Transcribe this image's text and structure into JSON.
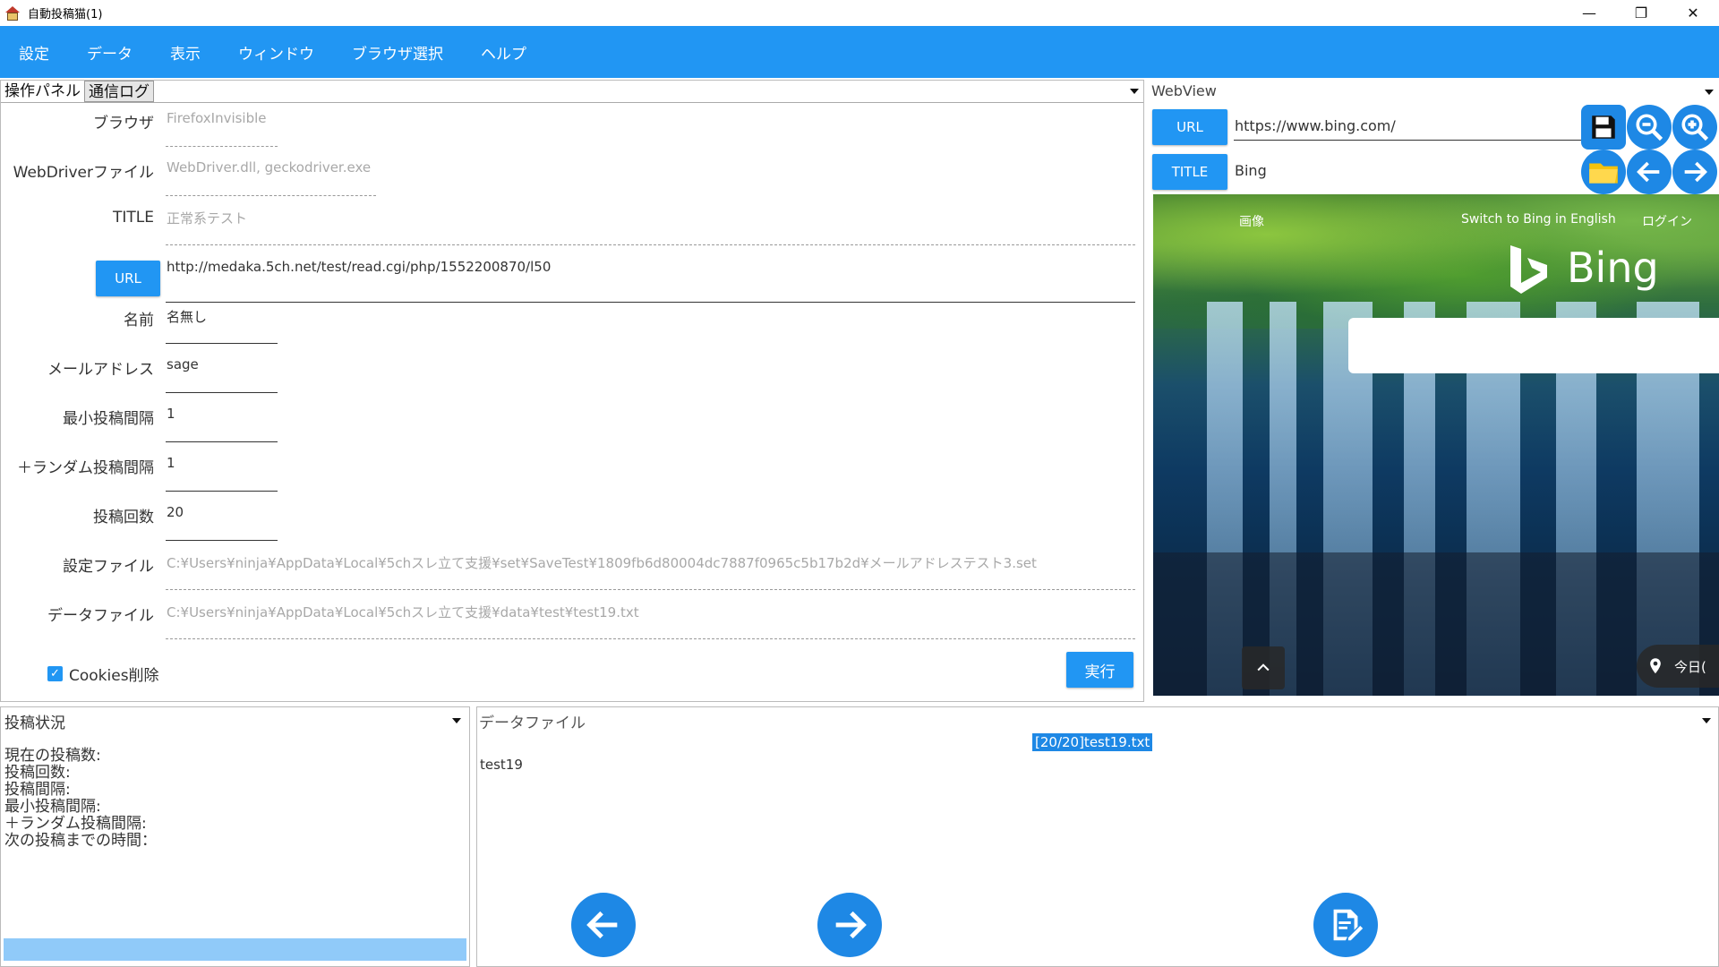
{
  "window": {
    "title": "自動投稿猫(1)",
    "controls": {
      "minimize": "—",
      "maximize": "❐",
      "close": "✕"
    }
  },
  "menubar": {
    "items": [
      "設定",
      "データ",
      "表示",
      "ウィンドウ",
      "ブラウザ選択",
      "ヘルプ"
    ]
  },
  "op_panel": {
    "tabs": [
      "操作パネル",
      "通信ログ"
    ],
    "fields": {
      "browser": {
        "label": "ブラウザ",
        "value": "FirefoxInvisible"
      },
      "webdriver": {
        "label": "WebDriverファイル",
        "value": "WebDriver.dll, geckodriver.exe"
      },
      "title": {
        "label": "TITLE",
        "value": "正常系テスト"
      },
      "url": {
        "button": "URL",
        "value": "http://medaka.5ch.net/test/read.cgi/php/1552200870/l50"
      },
      "name": {
        "label": "名前",
        "value": "名無し"
      },
      "mail": {
        "label": "メールアドレス",
        "value": "sage"
      },
      "min_interval": {
        "label": "最小投稿間隔",
        "value": "1"
      },
      "random_interval": {
        "label": "＋ランダム投稿間隔",
        "value": "1"
      },
      "post_count": {
        "label": "投稿回数",
        "value": "20"
      },
      "settings_file": {
        "label": "設定ファイル",
        "value": "C:¥Users¥ninja¥AppData¥Local¥5chスレ立て支援¥set¥SaveTest¥1809fb6d80004dc7887f0965c5b17b2d¥メールアドレステスト3.set"
      },
      "data_file": {
        "label": "データファイル",
        "value": "C:¥Users¥ninja¥AppData¥Local¥5chスレ立て支援¥data¥test¥test19.txt"
      }
    },
    "cookies": {
      "label": "Cookies削除",
      "checked": true
    },
    "run_button": "実行"
  },
  "webview": {
    "title": "WebView",
    "url_button": "URL",
    "url_value": "https://www.bing.com/",
    "title_button": "TITLE",
    "title_value": "Bing",
    "icons": [
      "save-icon",
      "zoom-out-icon",
      "zoom-in-icon",
      "folder-icon",
      "back-icon",
      "forward-icon"
    ],
    "page": {
      "images_link": "画像",
      "switch_link": "Switch to Bing in English",
      "login_link": "ログイン",
      "logo_text": "Bing",
      "today_label": "今日(",
      "colors": {
        "foliage": "#5c9b3b",
        "water": "#0e3a62"
      }
    }
  },
  "status_panel": {
    "title": "投稿状況",
    "lines": [
      "現在の投稿数:",
      "投稿回数:",
      "投稿間隔:",
      "最小投稿間隔:",
      "＋ランダム投稿間隔:",
      "次の投稿までの時間："
    ],
    "progress": 1.0
  },
  "data_panel": {
    "title": "データファイル",
    "badge": "[20/20]test19.txt",
    "content": "test19",
    "buttons": [
      "back-icon",
      "forward-icon",
      "edit-icon"
    ]
  },
  "colors": {
    "accent": "#2196f3",
    "icon_blue": "#1e88e5"
  }
}
